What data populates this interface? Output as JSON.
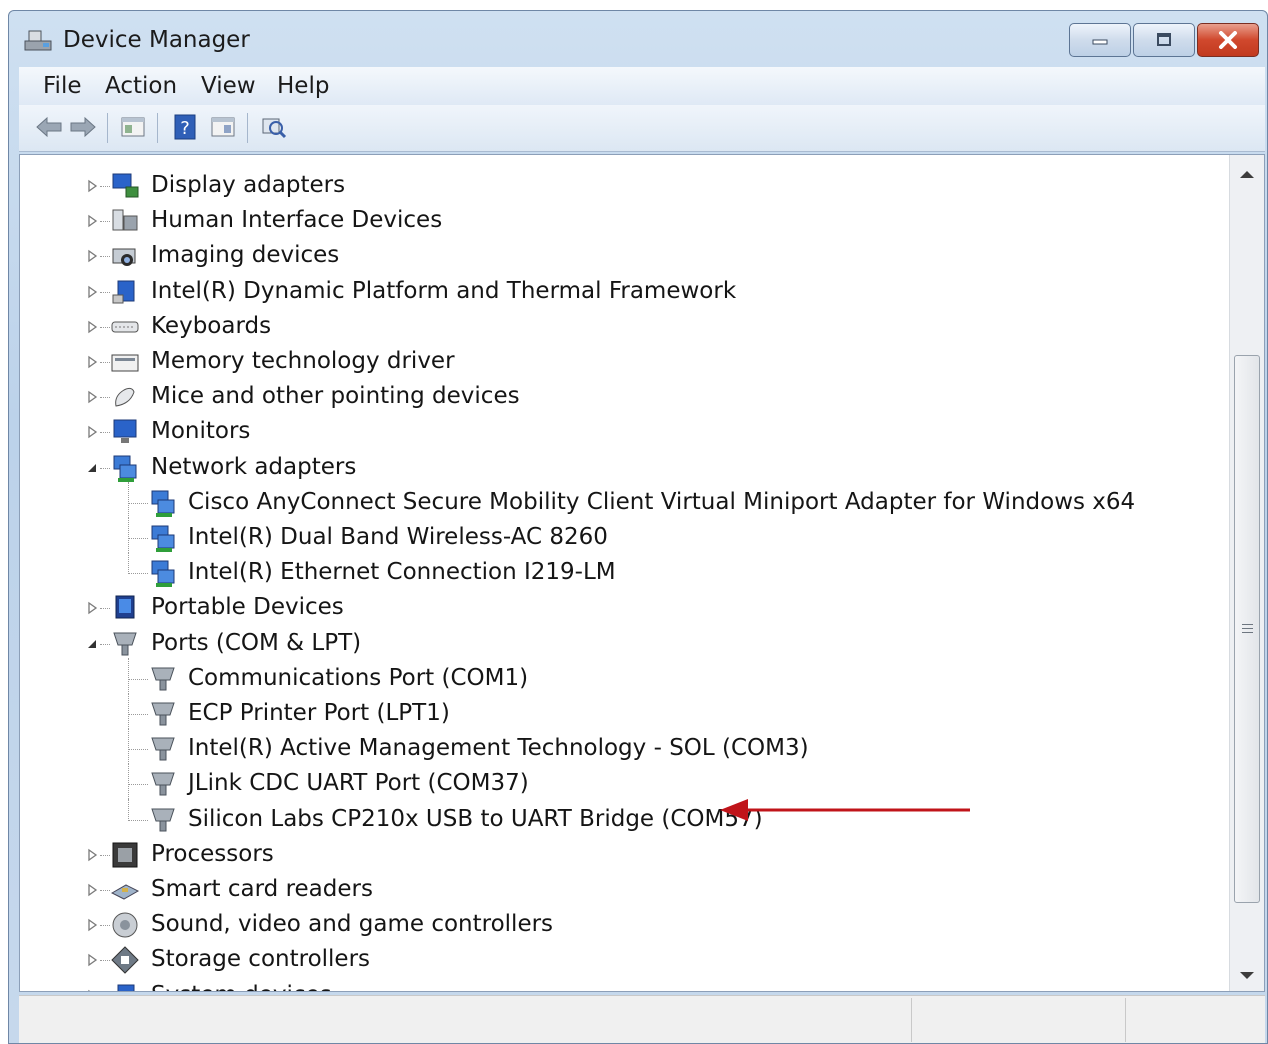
{
  "window": {
    "title": "Device Manager"
  },
  "menu": [
    "File",
    "Action",
    "View",
    "Help"
  ],
  "toolbar": [
    "back-icon",
    "forward-icon",
    "console-tree-icon",
    "help-icon",
    "properties-icon",
    "scan-hardware-icon"
  ],
  "tree": {
    "items": [
      {
        "label": "Display adapters",
        "icon": "display-adapter-icon",
        "expanded": false
      },
      {
        "label": "Human Interface Devices",
        "icon": "hid-icon",
        "expanded": false
      },
      {
        "label": "Imaging devices",
        "icon": "camera-icon",
        "expanded": false
      },
      {
        "label": "Intel(R) Dynamic Platform and Thermal Framework",
        "icon": "thermal-icon",
        "expanded": false
      },
      {
        "label": "Keyboards",
        "icon": "keyboard-icon",
        "expanded": false
      },
      {
        "label": "Memory technology driver",
        "icon": "memory-icon",
        "expanded": false
      },
      {
        "label": "Mice and other pointing devices",
        "icon": "mouse-icon",
        "expanded": false
      },
      {
        "label": "Monitors",
        "icon": "monitor-icon",
        "expanded": false
      },
      {
        "label": "Network adapters",
        "icon": "network-icon",
        "expanded": true
      },
      {
        "label": "Cisco AnyConnect Secure Mobility Client Virtual Miniport Adapter for Windows x64",
        "icon": "network-icon",
        "child": true
      },
      {
        "label": "Intel(R) Dual Band Wireless-AC 8260",
        "icon": "network-icon",
        "child": true
      },
      {
        "label": "Intel(R) Ethernet Connection I219-LM",
        "icon": "network-icon",
        "child": true
      },
      {
        "label": "Portable Devices",
        "icon": "portable-device-icon",
        "expanded": false
      },
      {
        "label": "Ports (COM & LPT)",
        "icon": "port-icon",
        "expanded": true
      },
      {
        "label": "Communications Port (COM1)",
        "icon": "port-icon",
        "child": true
      },
      {
        "label": "ECP Printer Port (LPT1)",
        "icon": "port-icon",
        "child": true
      },
      {
        "label": "Intel(R) Active Management Technology - SOL (COM3)",
        "icon": "port-icon",
        "child": true
      },
      {
        "label": "JLink CDC UART Port (COM37)",
        "icon": "port-icon",
        "child": true
      },
      {
        "label": "Silicon Labs CP210x USB to UART Bridge (COM57)",
        "icon": "port-icon",
        "child": true,
        "highlighted_by_arrow": true
      },
      {
        "label": "Processors",
        "icon": "processor-icon",
        "expanded": false
      },
      {
        "label": "Smart card readers",
        "icon": "smart-card-icon",
        "expanded": false
      },
      {
        "label": "Sound, video and game controllers",
        "icon": "speaker-icon",
        "expanded": false
      },
      {
        "label": "Storage controllers",
        "icon": "storage-icon",
        "expanded": false
      },
      {
        "label": "System devices",
        "icon": "system-icon",
        "expanded": false
      }
    ]
  },
  "colors": {
    "annotation_arrow": "#c0141a",
    "title_bar": "#c6d8ec",
    "close_button": "#c23a1f"
  }
}
